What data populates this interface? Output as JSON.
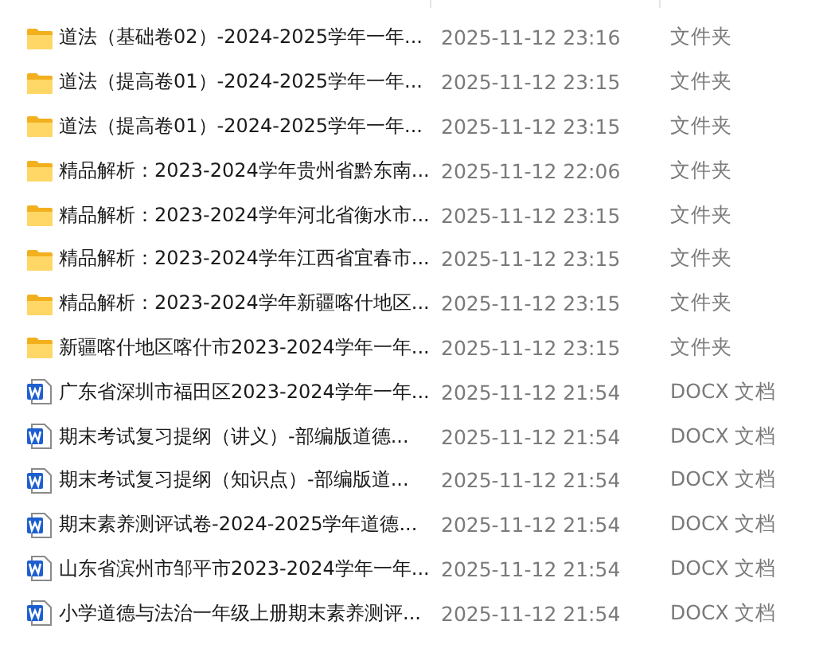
{
  "files": [
    {
      "kind": "folder",
      "name": "道法（基础卷02）-2024-2025学年一年...",
      "modified": "2025-11-12 23:16",
      "type": "文件夹"
    },
    {
      "kind": "folder",
      "name": "道法（提高卷01）-2024-2025学年一年...",
      "modified": "2025-11-12 23:15",
      "type": "文件夹"
    },
    {
      "kind": "folder",
      "name": "道法（提高卷01）-2024-2025学年一年...",
      "modified": "2025-11-12 23:15",
      "type": "文件夹"
    },
    {
      "kind": "folder",
      "name": "精品解析：2023-2024学年贵州省黔东南...",
      "modified": "2025-11-12 22:06",
      "type": "文件夹"
    },
    {
      "kind": "folder",
      "name": "精品解析：2023-2024学年河北省衡水市...",
      "modified": "2025-11-12 23:15",
      "type": "文件夹"
    },
    {
      "kind": "folder",
      "name": "精品解析：2023-2024学年江西省宜春市...",
      "modified": "2025-11-12 23:15",
      "type": "文件夹"
    },
    {
      "kind": "folder",
      "name": "精品解析：2023-2024学年新疆喀什地区...",
      "modified": "2025-11-12 23:15",
      "type": "文件夹"
    },
    {
      "kind": "folder",
      "name": "新疆喀什地区喀什市2023-2024学年一年...",
      "modified": "2025-11-12 23:15",
      "type": "文件夹"
    },
    {
      "kind": "docx",
      "name": "广东省深圳市福田区2023-2024学年一年...",
      "modified": "2025-11-12 21:54",
      "type": "DOCX 文档"
    },
    {
      "kind": "docx",
      "name": "期末考试复习提纲（讲义）-部编版道德...",
      "modified": "2025-11-12 21:54",
      "type": "DOCX 文档"
    },
    {
      "kind": "docx",
      "name": "期末考试复习提纲（知识点）-部编版道...",
      "modified": "2025-11-12 21:54",
      "type": "DOCX 文档"
    },
    {
      "kind": "docx",
      "name": "期末素养测评试卷-2024-2025学年道德...",
      "modified": "2025-11-12 21:54",
      "type": "DOCX 文档"
    },
    {
      "kind": "docx",
      "name": "山东省滨州市邹平市2023-2024学年一年...",
      "modified": "2025-11-12 21:54",
      "type": "DOCX 文档"
    },
    {
      "kind": "docx",
      "name": "小学道德与法治一年级上册期末素养测评...",
      "modified": "2025-11-12 21:54",
      "type": "DOCX 文档"
    }
  ]
}
